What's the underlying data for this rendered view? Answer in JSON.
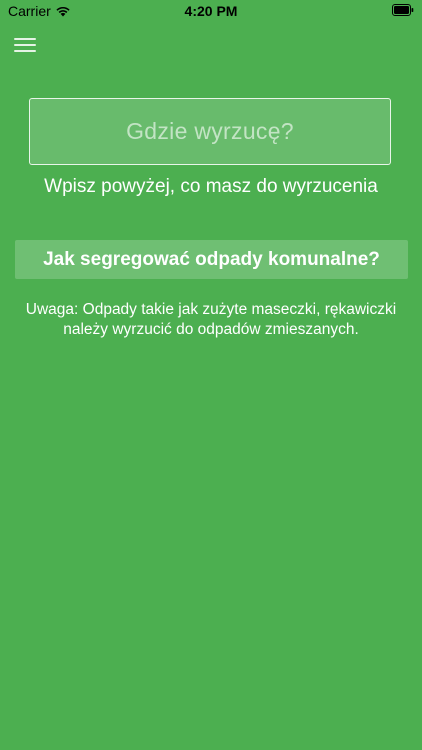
{
  "status_bar": {
    "carrier": "Carrier",
    "time": "4:20 PM",
    "wifi_icon": "wifi-icon",
    "battery_icon": "battery-icon"
  },
  "menu": {
    "icon": "hamburger-menu-icon"
  },
  "search": {
    "placeholder": "Gdzie wyrzucę?",
    "value": ""
  },
  "hint_text": "Wpisz powyżej, co masz do wyrzucenia",
  "guide_button_label": "Jak segregować odpady komunalne?",
  "notice_text": "Uwaga: Odpady takie jak zużyte maseczki, rękawiczki należy wyrzucić do odpadów zmieszanych.",
  "colors": {
    "background": "#4caf50",
    "text": "#ffffff"
  }
}
